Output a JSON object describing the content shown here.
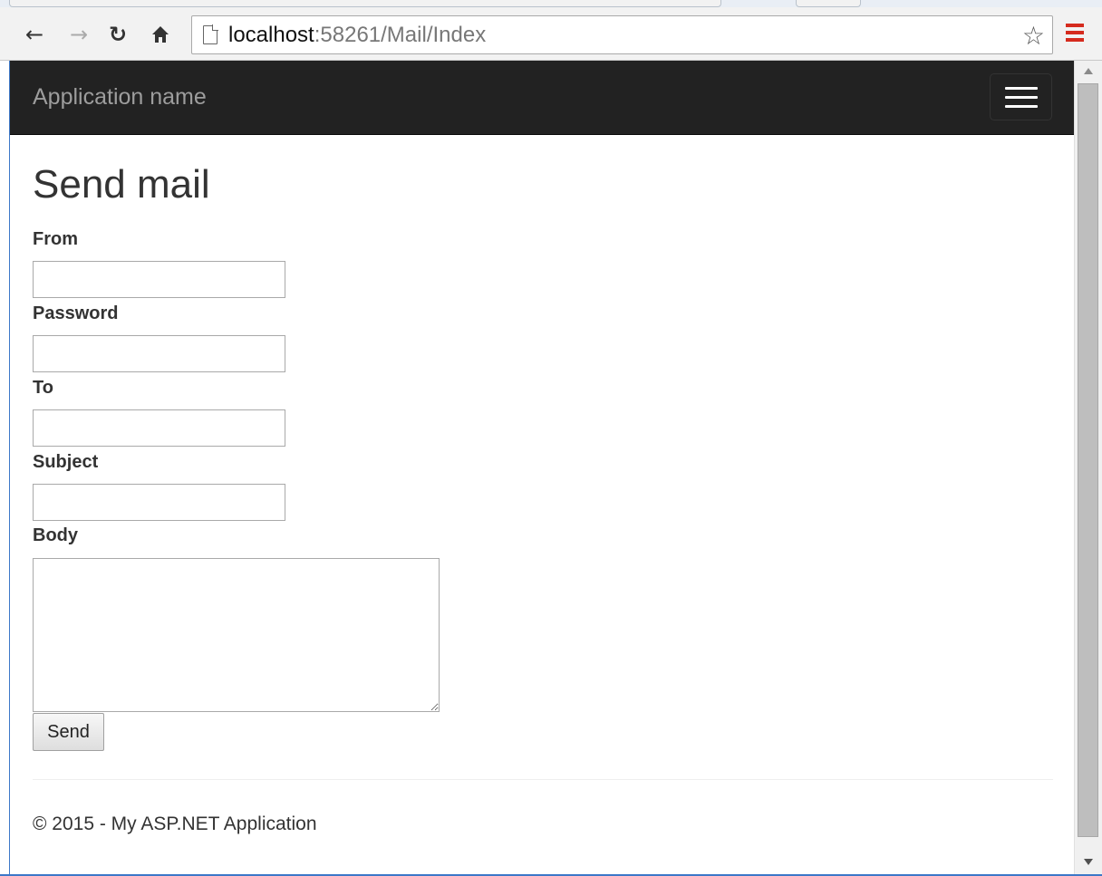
{
  "browser": {
    "url_host": "localhost",
    "url_path": ":58261/Mail/Index",
    "icons": {
      "back": "back-arrow-icon",
      "forward": "forward-arrow-icon",
      "reload": "reload-icon",
      "home": "home-icon",
      "page": "page-icon",
      "bookmark": "star-icon",
      "menu": "menu-icon"
    },
    "menu_color": "#d52b1e"
  },
  "navbar": {
    "brand": "Application name",
    "background": "#222222"
  },
  "page": {
    "title": "Send mail",
    "fields": {
      "from_label": "From",
      "from_value": "",
      "password_label": "Password",
      "password_value": "",
      "to_label": "To",
      "to_value": "",
      "subject_label": "Subject",
      "subject_value": "",
      "body_label": "Body",
      "body_value": ""
    },
    "send_label": "Send"
  },
  "footer": {
    "text": "© 2015 - My ASP.NET Application"
  }
}
